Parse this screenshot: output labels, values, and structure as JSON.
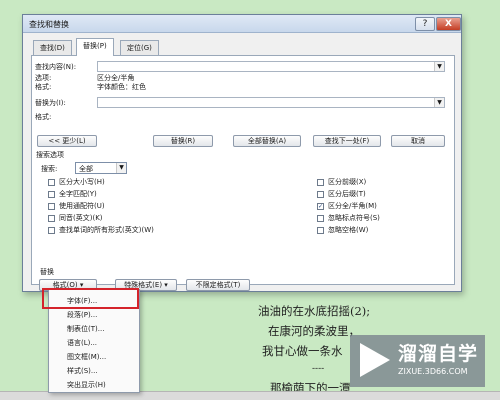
{
  "dialog": {
    "title": "查找和替换",
    "help_label": "?",
    "close_label": "X",
    "tabs": [
      {
        "label": "查找(D)"
      },
      {
        "label": "替换(P)"
      },
      {
        "label": "定位(G)"
      }
    ],
    "find_label": "查找内容(N):",
    "find_value": "",
    "options_label": "选项:",
    "options_value": "区分全/半角",
    "format_label": "格式:",
    "format_value": "字体颜色：红色",
    "replace_label": "替换为(I):",
    "replace_value": "",
    "replace_format_label": "格式:",
    "buttons": {
      "less": "<< 更少(L)",
      "replace": "替换(R)",
      "replace_all": "全部替换(A)",
      "find_next": "查找下一处(F)",
      "cancel": "取消"
    },
    "search_options_title": "搜索选项",
    "search_label": "搜索:",
    "search_value": "全部",
    "checkboxes_left": [
      {
        "label": "区分大小写(H)",
        "checked": false
      },
      {
        "label": "全字匹配(Y)",
        "checked": false
      },
      {
        "label": "使用通配符(U)",
        "checked": false
      },
      {
        "label": "同音(英文)(K)",
        "checked": false
      },
      {
        "label": "查找单词的所有形式(英文)(W)",
        "checked": false
      }
    ],
    "checkboxes_right": [
      {
        "label": "区分前缀(X)",
        "checked": false
      },
      {
        "label": "区分后缀(T)",
        "checked": false
      },
      {
        "label": "区分全/半角(M)",
        "checked": true
      },
      {
        "label": "忽略标点符号(S)",
        "checked": false
      },
      {
        "label": "忽略空格(W)",
        "checked": false
      }
    ],
    "replace_section_title": "替换",
    "bottom_buttons": {
      "format": "格式(O) ▾",
      "special": "特殊格式(E) ▾",
      "no_format": "不限定格式(T)"
    }
  },
  "format_menu": {
    "items": [
      {
        "label": "字体(F)..."
      },
      {
        "label": "段落(P)..."
      },
      {
        "label": "制表位(T)..."
      },
      {
        "label": "语言(L)..."
      },
      {
        "label": "图文框(M)..."
      },
      {
        "label": "样式(S)..."
      },
      {
        "label": "突出显示(H)"
      }
    ]
  },
  "document": {
    "lines": [
      "油油的在水底招摇(2);",
      "在康河的柔波里，",
      "我甘心做一条水",
      "----",
      "那榆荫下的一潭"
    ]
  },
  "watermark": {
    "brand": "溜溜自学",
    "url": "ZIXUE.3D66.COM"
  }
}
